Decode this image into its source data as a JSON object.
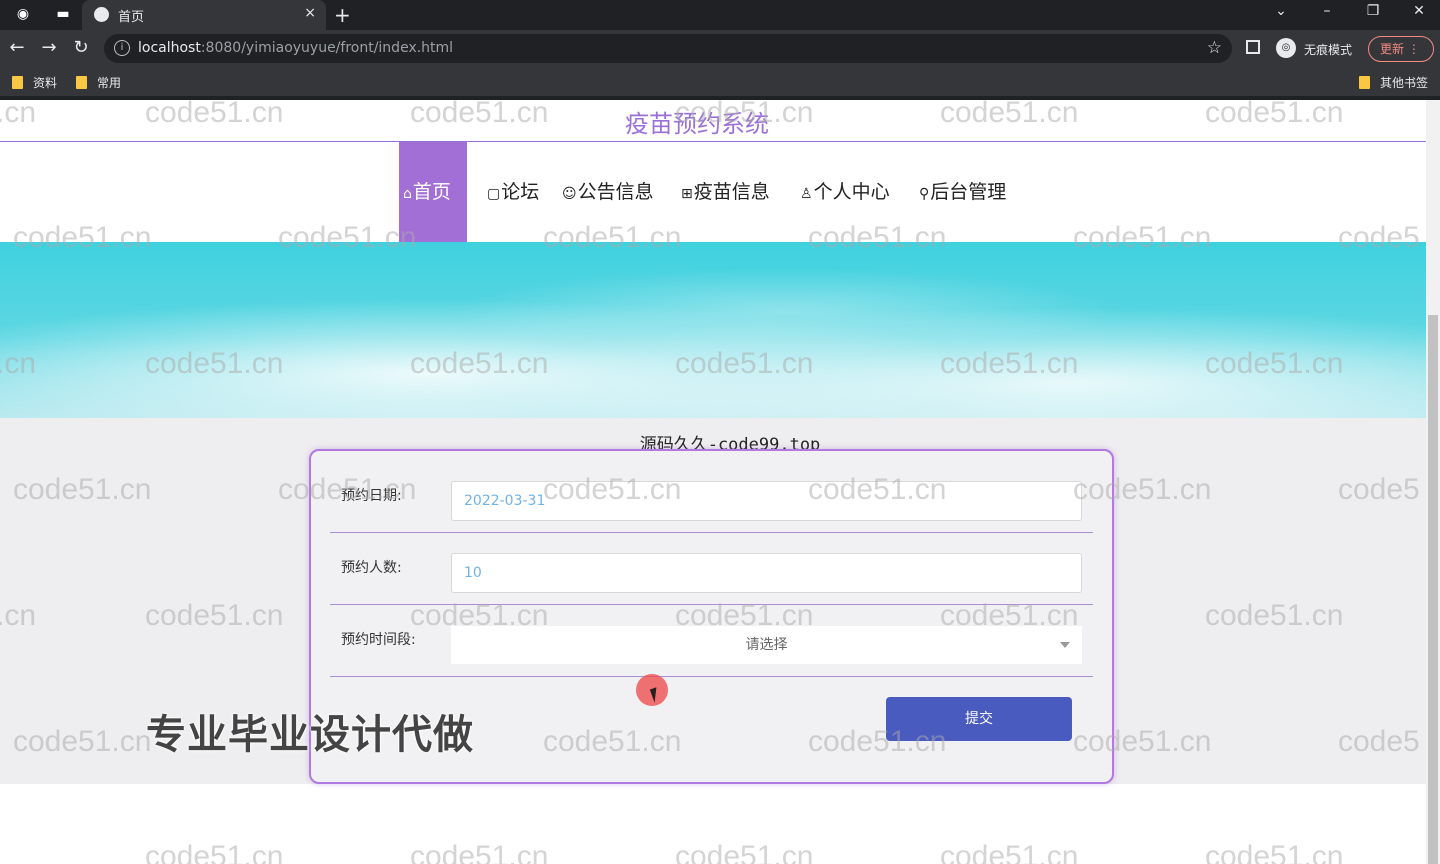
{
  "browser": {
    "tab_title": "首页",
    "tab_close": "×",
    "new_tab": "+",
    "url_host": "localhost",
    "url_rest": ":8080/yimiaoyuyue/front/index.html",
    "incognito_label": "无痕模式",
    "update_label": "更新",
    "bookmarks": [
      "资料",
      "常用"
    ],
    "other_bookmarks": "其他书签"
  },
  "site": {
    "title": "疫苗预约系统",
    "nav": [
      {
        "icon": "⌂",
        "label": "首页",
        "active": true
      },
      {
        "icon": "▢",
        "label": "论坛",
        "active": false
      },
      {
        "icon": "☺",
        "label": "公告信息",
        "active": false
      },
      {
        "icon": "⊞",
        "label": "疫苗信息",
        "active": false
      },
      {
        "icon": "♙",
        "label": "个人中心",
        "active": false
      },
      {
        "icon": "⚲",
        "label": "后台管理",
        "active": false
      }
    ]
  },
  "carousel": {
    "slides": 3,
    "active": 1
  },
  "form": {
    "title": "源码久久-code99.top",
    "fields": [
      {
        "label": "预约日期:",
        "value": "2022-03-31"
      },
      {
        "label": "预约人数:",
        "value": "10"
      },
      {
        "label": "预约时间段:",
        "placeholder": "请选择"
      }
    ],
    "submit_label": "提交"
  },
  "overlay": {
    "promo_text": "专业毕业设计代做",
    "watermark": "code51.cn"
  },
  "colors": {
    "accent": "#a26fd6",
    "submit": "#4a5bbf",
    "input_text": "#6fb3e6"
  }
}
